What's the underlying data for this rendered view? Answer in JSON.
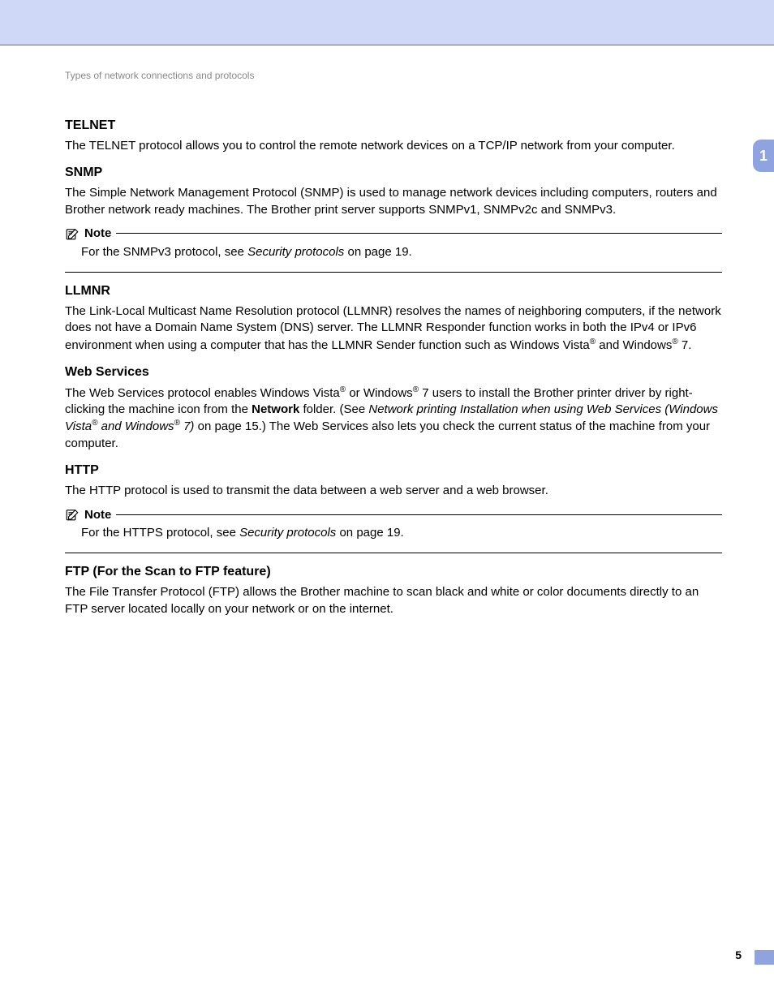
{
  "breadcrumb": "Types of network connections and protocols",
  "chapterTab": "1",
  "pageNumber": "5",
  "sections": {
    "telnet": {
      "heading": "TELNET",
      "body": "The TELNET protocol allows you to control the remote network devices on a TCP/IP network from your computer."
    },
    "snmp": {
      "heading": "SNMP",
      "body": "The Simple Network Management Protocol (SNMP) is used to manage network devices including computers, routers and Brother network ready machines. The Brother print server supports SNMPv1, SNMPv2c and SNMPv3.",
      "noteLabel": "Note",
      "notePre": "For the SNMPv3 protocol, see ",
      "noteItalic": "Security protocols",
      "notePost": " on page 19."
    },
    "llmnr": {
      "heading": "LLMNR",
      "bodyPre": "The Link-Local Multicast Name Resolution protocol (LLMNR) resolves the names of neighboring computers, if the network does not have a Domain Name System (DNS) server. The LLMNR Responder function works in both the IPv4 or IPv6 environment when using a computer that has the LLMNR Sender function such as Windows Vista",
      "reg": "®",
      "bodyMid": " and Windows",
      "bodyPost": " 7."
    },
    "webservices": {
      "heading": "Web Services",
      "p1a": "The Web Services protocol enables Windows Vista",
      "reg": "®",
      "p1b": " or Windows",
      "p1c": " 7 users to install the Brother printer driver by right-clicking the machine icon from the ",
      "bold1": "Network",
      "p1d": " folder. (See ",
      "italic1a": "Network printing Installation when using Web Services (Windows Vista",
      "italic1b": " and Windows",
      "italic1c": " 7)",
      "p1e": " on page 15.) The Web Services also lets you check the current status of the machine from your computer."
    },
    "http": {
      "heading": "HTTP",
      "body": "The HTTP protocol is used to transmit the data between a web server and a web browser.",
      "noteLabel": "Note",
      "notePre": "For the HTTPS protocol, see ",
      "noteItalic": "Security protocols",
      "notePost": " on page 19."
    },
    "ftp": {
      "heading": "FTP (For the Scan to FTP feature)",
      "body": "The File Transfer Protocol (FTP) allows the Brother machine to scan black and white or color documents directly to an FTP server located locally on your network or on the internet."
    }
  }
}
